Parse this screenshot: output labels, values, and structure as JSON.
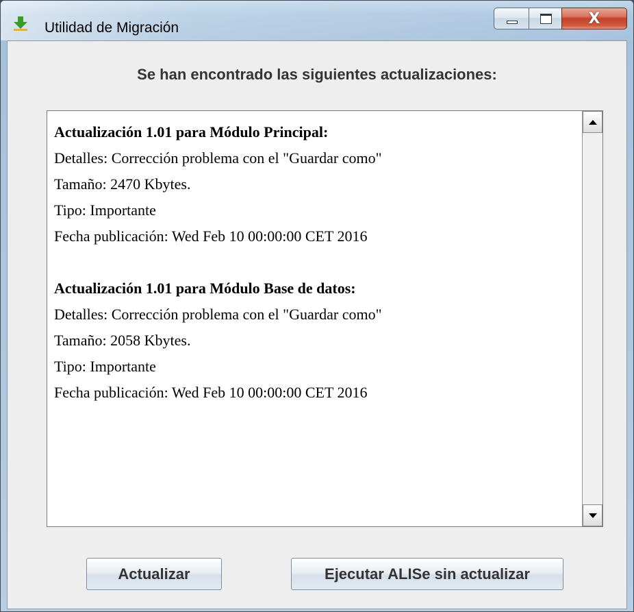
{
  "window": {
    "title": "Utilidad de Migración",
    "icon": "download-arrow-icon",
    "caption_buttons": {
      "minimize": "minimize-icon",
      "maximize": "maximize-icon",
      "close_label": "X"
    }
  },
  "heading": "Se han encontrado las siguientes actualizaciones:",
  "updates": [
    {
      "title": "Actualización 1.01 para Módulo Principal:",
      "details": "Detalles: Corrección problema con el \"Guardar como\"",
      "size": "Tamaño: 2470 Kbytes.",
      "type": "Tipo: Importante",
      "date": "Fecha publicación: Wed Feb 10 00:00:00 CET 2016"
    },
    {
      "title": "Actualización 1.01 para Módulo Base de datos:",
      "details": "Detalles: Corrección problema con el \"Guardar como\"",
      "size": "Tamaño: 2058 Kbytes.",
      "type": "Tipo: Importante",
      "date": "Fecha publicación: Wed Feb 10 00:00:00 CET 2016"
    }
  ],
  "buttons": {
    "update_label": "Actualizar",
    "run_label": "Ejecutar ALISe sin actualizar"
  },
  "colors": {
    "icon_green": "#3a9a2a",
    "close_red": "#c4432a"
  }
}
